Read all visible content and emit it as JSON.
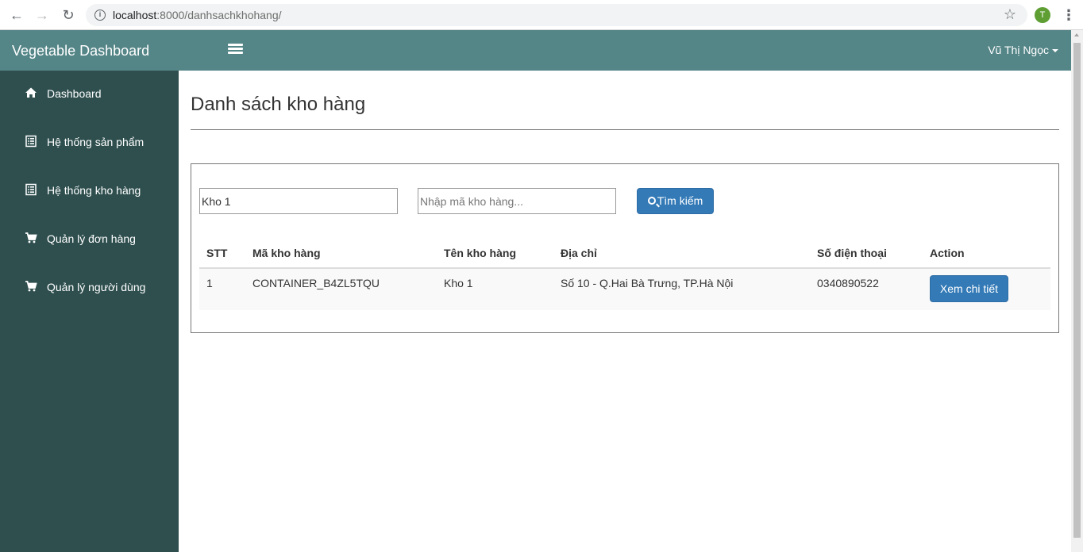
{
  "browser": {
    "url_host": "localhost",
    "url_path": ":8000/danhsachkhohang/",
    "profile_initial": "T"
  },
  "app": {
    "brand": "Vegetable Dashboard",
    "user_name": "Vũ Thị Ngọc",
    "accent_color": "#548587",
    "sidebar_color": "#2f4f4f",
    "button_color": "#337ab7"
  },
  "sidebar": {
    "items": [
      {
        "label": "Dashboard",
        "icon": "home-icon"
      },
      {
        "label": "Hệ thống sản phẩm",
        "icon": "list-icon"
      },
      {
        "label": "Hệ thống kho hàng",
        "icon": "list-icon"
      },
      {
        "label": "Quản lý đơn hàng",
        "icon": "cart-icon"
      },
      {
        "label": "Quản lý người dùng",
        "icon": "cart-icon"
      }
    ]
  },
  "main": {
    "title": "Danh sách kho hàng",
    "search": {
      "name_value": "Kho 1",
      "code_value": "",
      "code_placeholder": "Nhập mã kho hàng...",
      "button_label": "Tìm kiếm"
    },
    "table": {
      "headers": [
        "STT",
        "Mã kho hàng",
        "Tên kho hàng",
        "Địa chỉ",
        "Số điện thoại",
        "Action"
      ],
      "rows": [
        {
          "stt": "1",
          "code": "CONTAINER_B4ZL5TQU",
          "name": "Kho 1",
          "address": "Số 10 - Q.Hai Bà Trưng, TP.Hà Nội",
          "phone": "0340890522",
          "action": "Xem chi tiết"
        }
      ]
    }
  }
}
